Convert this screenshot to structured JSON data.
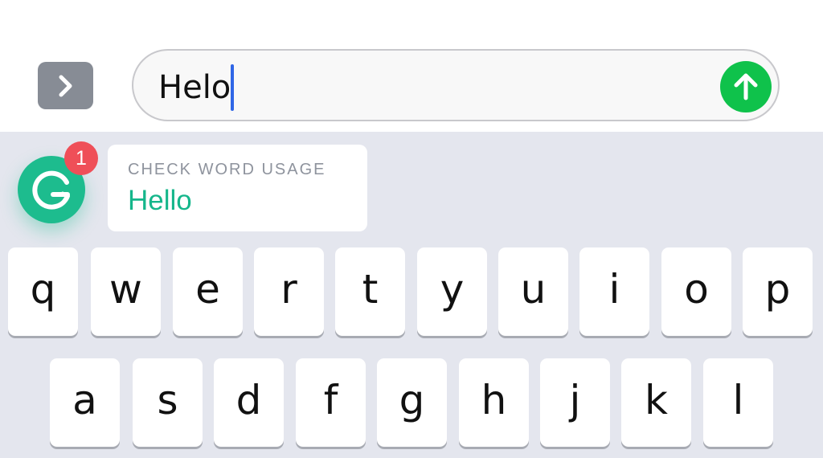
{
  "message": {
    "text": "Helo"
  },
  "grammarly": {
    "badge_count": "1",
    "suggestion_heading": "CHECK WORD USAGE",
    "suggestion_word": "Hello"
  },
  "keyboard": {
    "row1": [
      "q",
      "w",
      "e",
      "r",
      "t",
      "y",
      "u",
      "i",
      "o",
      "p"
    ],
    "row2": [
      "a",
      "s",
      "d",
      "f",
      "g",
      "h",
      "j",
      "k",
      "l"
    ]
  },
  "colors": {
    "send_button": "#0fc24b",
    "grammarly_green": "#1dbc8e",
    "badge_red": "#ef4f58",
    "caret_blue": "#2f66e6",
    "keyboard_bg": "#e4e6ee"
  },
  "icons": {
    "expand": "chevron-right-icon",
    "send": "arrow-up-icon",
    "grammarly": "grammarly-g-icon"
  }
}
